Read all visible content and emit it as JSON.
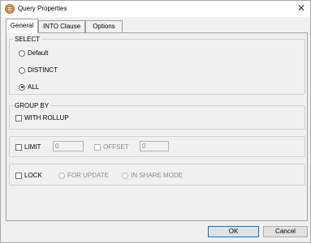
{
  "window": {
    "title": "Query Properties",
    "close_glyph": "✕"
  },
  "tabs": [
    {
      "label": "General",
      "active": true
    },
    {
      "label": "INTO Clause",
      "active": false
    },
    {
      "label": "Options",
      "active": false
    }
  ],
  "select_group": {
    "label": "SELECT",
    "options": [
      {
        "label": "Default",
        "checked": false
      },
      {
        "label": "DISTINCT",
        "checked": false
      },
      {
        "label": "ALL",
        "checked": true
      }
    ]
  },
  "group_by": {
    "label": "GROUP BY",
    "with_rollup": "WITH ROLLUP"
  },
  "limit": {
    "label": "LIMIT",
    "value": "0",
    "offset_label": "OFFSET",
    "offset_value": "0"
  },
  "lock": {
    "label": "LOCK",
    "for_update": "FOR UPDATE",
    "in_share_mode": "IN SHARE MODE"
  },
  "buttons": {
    "ok": "OK",
    "cancel": "Cancel"
  },
  "colors": {
    "accent": "#0078d7",
    "panel_bg": "#f0f0f0",
    "icon_orange": "#e8a33d"
  }
}
